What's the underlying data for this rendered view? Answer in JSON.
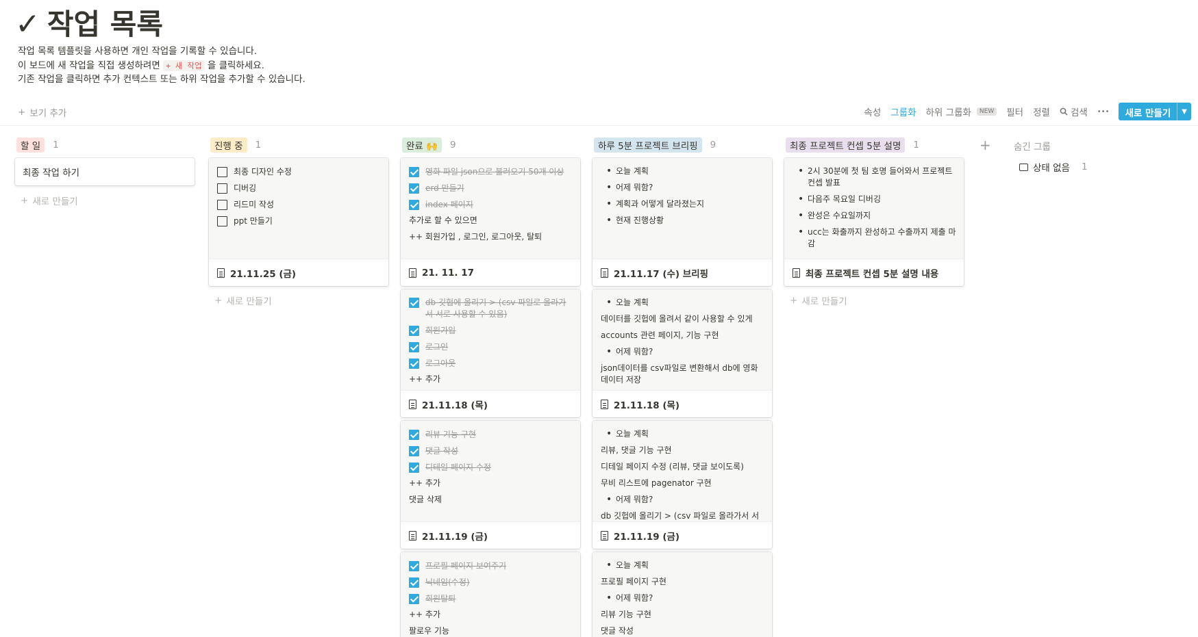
{
  "page": {
    "icon": "✓",
    "title": "작업 목록",
    "desc_line1": "작업 목록 템플릿을 사용하면 개인 작업을 기록할 수 있습니다.",
    "desc_line2_pre": "이 보드에 새 작업을 직접 생성하려면",
    "desc_line2_code": "+ 새 작업",
    "desc_line2_post": "을 클릭하세요.",
    "desc_line3": "기존 작업을 클릭하면 추가 컨텍스트 또는 하위 작업을 추가할 수 있습니다."
  },
  "toolbar": {
    "add_view": "보기 추가",
    "properties": "속성",
    "group": "그룹화",
    "subgroup": "하위 그룹화",
    "new_badge": "NEW",
    "filter": "필터",
    "sort": "정렬",
    "search": "검색",
    "more": "•••",
    "new_button": "새로 만들기",
    "accent": "#2eaadc"
  },
  "add_new_label": "새로 만들기",
  "columns": [
    {
      "name": "할 일",
      "count": "1",
      "color": "#ffe2dd"
    },
    {
      "name": "진행 중",
      "count": "1",
      "color": "#fdecc8"
    },
    {
      "name": "완료 🙌",
      "count": "9",
      "color": "#dbeddb"
    },
    {
      "name": "하루 5분 프로젝트 브리핑",
      "count": "9",
      "color": "#d3e5ef"
    },
    {
      "name": "최종 프로젝트 컨셉 5분 설명",
      "count": "1",
      "color": "#e8deee"
    }
  ],
  "cards": {
    "todo": {
      "title": "최종 작업 하기"
    },
    "inprogress": {
      "items": [
        "최종 디자인 수정",
        "디버깅",
        "리드미 작성",
        "ppt 만들기"
      ],
      "footer": "21.11.25 (금)"
    },
    "done1": {
      "checks": [
        "영화 파일 json으로 불러오기 50개 이상",
        "erd 만들기",
        "index 페이지"
      ],
      "lines": [
        "추가로 할 수 있으면",
        "++ 회원가입 , 로그인, 로그아웃, 탈퇴"
      ],
      "footer": "21. 11. 17"
    },
    "done2": {
      "checks": [
        "db 깃헙에 올리기 > (csv 파일로 올라가서 서로 사용할 수 있음)",
        "회원가입",
        "로그인",
        "로그아웃"
      ],
      "lines": [
        "++ 추가"
      ],
      "footer": "21.11.18 (목)"
    },
    "done3": {
      "checks": [
        "리뷰 기능 구현",
        "댓글 작성",
        "디테일 페이지 수정"
      ],
      "lines": [
        "++ 추가",
        "댓글 삭제"
      ],
      "footer": "21.11.19 (금)"
    },
    "done4": {
      "checks": [
        "프로필 페이지 보여주기",
        "닉네임(수정)",
        "회원탈퇴"
      ],
      "lines": [
        "++ 추가",
        "팔로우 기능"
      ]
    },
    "brief1": {
      "bullets": [
        "오늘 계획",
        "어제 뭐함?",
        "계획과 어떻게 달라졌는지",
        "현재 진행상황"
      ],
      "footer": "21.11.17 (수) 브리핑"
    },
    "brief2": {
      "b1": "오늘 계획",
      "p1": "데이터를 깃헙에 올려서 같이 사용할 수 있게",
      "p2": "accounts 관련 페이지, 기능 구현",
      "b2": "어제 뭐함?",
      "p3": "json데이터를 csv파일로 변환해서 db에 영화 데이터 저장",
      "footer": "21.11.18 (목)"
    },
    "brief3": {
      "b1": "오늘 계획",
      "p1": "리뷰, 댓글 기능 구현",
      "p2": "디테일 페이지 수정 (리뷰, 댓글 보이도록)",
      "p3": "무비 리스트에 pagenator 구현",
      "b2": "어제 뭐함?",
      "p4": "db 깃헙에 올리기 > (csv 파일로 올라가서 서",
      "footer": "21.11.19 (금)"
    },
    "brief4": {
      "b1": "오늘 계획",
      "p1": "프로필 페이지 구현",
      "b2": "어제 뭐함?",
      "p2": "리뷰 기능 구현",
      "p3": "댓글 작성"
    },
    "concept": {
      "bullets": [
        "2시 30분에 첫 팀 호명 들어와서 프로젝트 컨셉 발표",
        "다음주 목요일 디버깅",
        "완성은 수요일까지",
        "ucc는 화출까지 완성하고 수출까지 제출 마감"
      ],
      "footer": "최종 프로젝트 컨셉 5분 설명 내용"
    }
  },
  "hidden_groups": {
    "title": "숨긴 그룹",
    "item": "상태 없음",
    "count": "1"
  }
}
